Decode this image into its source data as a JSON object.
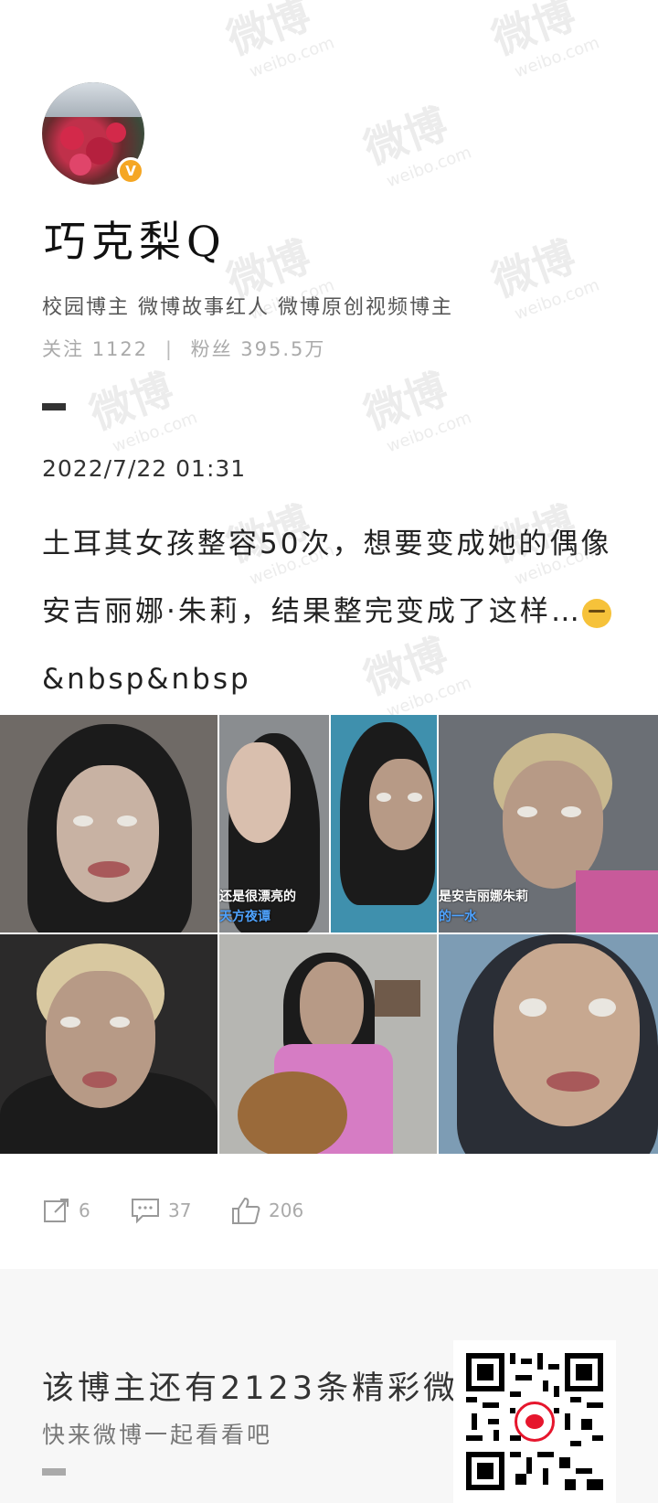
{
  "profile": {
    "username": "巧克梨Q",
    "verified_badge": "V",
    "tags": "校园博主 微博故事红人 微博原创视频博主",
    "following_label": "关注",
    "following_count": "1122",
    "followers_label": "粉丝",
    "followers_count": "395.5万"
  },
  "post": {
    "date": "2022/7/22 01:31",
    "text_before_emoji": "土耳其女孩整容50次，想要变成她的偶像安吉丽娜·朱莉，结果整完变成了这样…",
    "text_after_emoji": "&nbsp&nbsp",
    "emoji_name": "sleepy-emoji",
    "image_captions": {
      "photo2_line1": "还是很漂亮的",
      "photo2_line2": "天方夜谭",
      "photo4_line1": "是安吉丽娜朱莉",
      "photo4_line2": "的一水"
    }
  },
  "actions": {
    "repost_count": "6",
    "comment_count": "37",
    "like_count": "206"
  },
  "promo": {
    "title": "该博主还有2123条精彩微博",
    "subtitle": "快来微博一起看看吧"
  },
  "watermark": {
    "main": "微博",
    "sub": "weibo.com"
  },
  "colors": {
    "badge": "#f5a623",
    "weibo_red": "#e6162d",
    "muted": "#aaaaaa"
  }
}
